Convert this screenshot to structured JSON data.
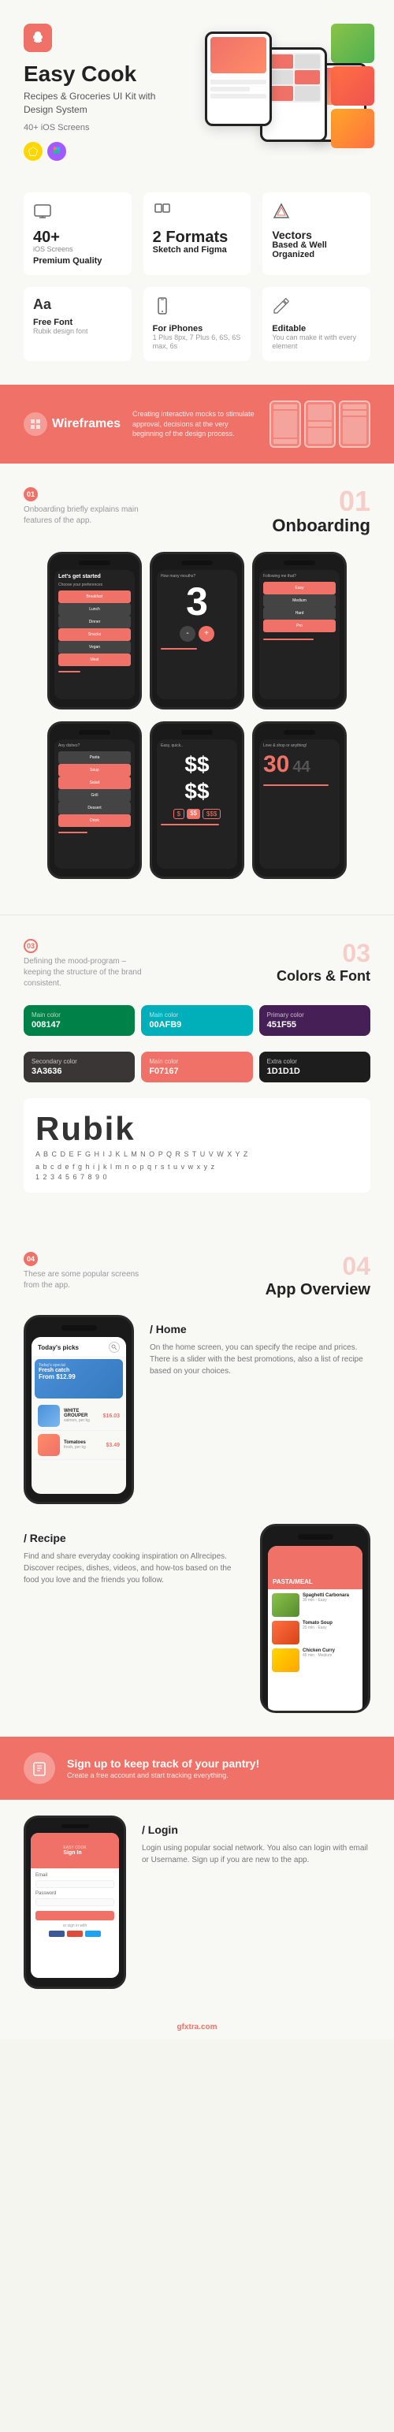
{
  "hero": {
    "logo_bg": "#f07167",
    "title": "Easy Cook",
    "subtitle": "Recipes & Groceries\nUI Kit with Design System",
    "meta": "40+ iOS Screens",
    "badge_sketch_label": "S",
    "badge_figma_label": "F"
  },
  "features": [
    {
      "icon": "screen-icon",
      "number": "40+",
      "number_label": "iOS Screens",
      "title": "Premium Quality"
    },
    {
      "icon": "format-icon",
      "number": "2 Formats",
      "title": "Sketch and Figma"
    },
    {
      "icon": "vector-icon",
      "number": "Vectors",
      "title": "Based & Well Organized"
    },
    {
      "icon": "font-icon",
      "letter": "Aa",
      "title": "Free Font",
      "desc": "Rubik design font"
    },
    {
      "icon": "iphone-icon",
      "title": "For iPhones",
      "desc": "1 Plus 8px, 7 Plus 6, 6S, 6S max, 6s"
    },
    {
      "icon": "edit-icon",
      "title": "Editable",
      "desc": "You can make it with every element"
    }
  ],
  "wireframes": {
    "logo_text": "Wireframes",
    "desc": "Creating interactive mocks to stimulate approval, decisions at the very beginning of the design process."
  },
  "onboarding": {
    "section_number": "01",
    "section_title": "Onboarding",
    "desc": "Onboarding briefly explains main features of the app.",
    "screens": [
      {
        "label": "Let's get started"
      },
      {
        "label": "How many mouths?",
        "number": "3"
      },
      {
        "label": "Following me that?"
      },
      {
        "label": "Any dishes?"
      },
      {
        "label": "Easy, quick..",
        "dollar": "$$$$"
      },
      {
        "label": "Love & shop or anything!",
        "number": "30"
      }
    ]
  },
  "colors": {
    "section_number": "03",
    "section_title": "Colors & Font",
    "desc": "Defining the mood-program – keeping the structure of the brand consistent.",
    "swatches": [
      {
        "label": "Main color",
        "hex": "008147",
        "bg": "#008147"
      },
      {
        "label": "Main color",
        "hex": "00AFB9",
        "bg": "#00AFB9"
      },
      {
        "label": "Primary color",
        "hex": "451F55",
        "bg": "#451F55"
      },
      {
        "label": "Secondary color",
        "hex": "3A3636",
        "bg": "#3A3636"
      },
      {
        "label": "Main color",
        "hex": "F07167",
        "bg": "#F07167"
      },
      {
        "label": "Extra color",
        "hex": "1D1D1D",
        "bg": "#1D1D1D"
      }
    ],
    "font_name": "Rubik",
    "alphabet_upper": "A B C D E F G H I J K L M N O P Q R S T U V W X Y Z",
    "alphabet_lower": "a b c d e f g h i j k l m n o p q r s t u v w x y z",
    "numbers": "1 2 3 4 5 6 7 8 9 0"
  },
  "app_overview": {
    "section_number": "04",
    "section_title": "App Overview",
    "desc": "These are some popular screens from the app.",
    "home": {
      "slash_title": "/ Home",
      "desc": "On the home screen, you can specify the recipe and prices. There is a slider with the best promotions, also a list of recipe based on your choices.",
      "phone_screen_title": "Today's picks",
      "item1_name": "WHITE GROUPER",
      "item1_price": "$16.03",
      "item1_sub": "salmon, per kg"
    },
    "recipe": {
      "slash_title": "/ Recipe",
      "desc": "Find and share everyday cooking inspiration on Allrecipes. Discover recipes, dishes, videos, and how-tos based on the food you love and the friends you follow.",
      "phone_title": "PASTA/MEAL"
    },
    "login": {
      "slash_title": "/ Login",
      "desc": "Login using popular social network. You also can login with email or Username. Sign up if you are new to the app."
    }
  },
  "signup_banner": {
    "title": "Sign up to keep track of your pantry!",
    "desc": "Create a free account and start tracking everything."
  },
  "watermark": {
    "text": "gfxtra.com"
  }
}
